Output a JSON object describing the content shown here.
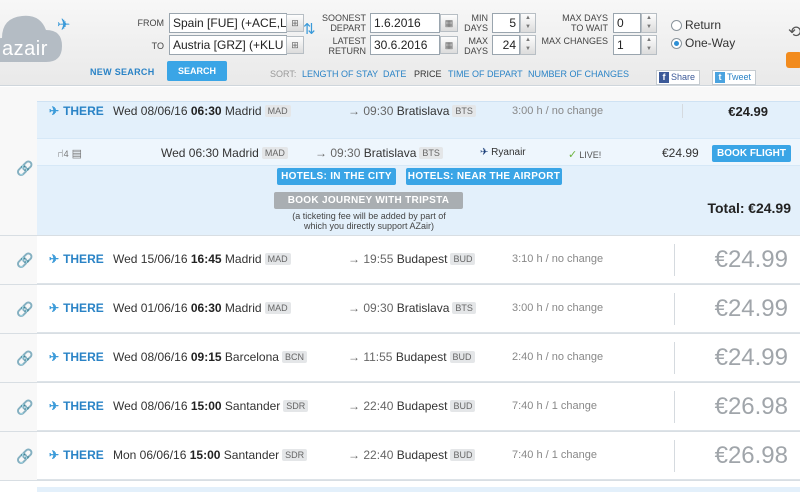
{
  "brand": {
    "logo_text": "azair"
  },
  "search": {
    "from_label": "FROM",
    "from_value": "Spain [FUE] (+ACE,L",
    "to_label": "TO",
    "to_value": "Austria [GRZ] (+KLU",
    "soonest_depart_label_1": "SOONEST",
    "soonest_depart_label_2": "DEPART",
    "soonest_depart_value": "1.6.2016",
    "latest_return_label_1": "LATEST",
    "latest_return_label_2": "RETURN",
    "latest_return_value": "30.6.2016",
    "min_days_label_1": "MIN",
    "min_days_label_2": "DAYS",
    "min_days_value": "5",
    "max_days_label_1": "MAX",
    "max_days_label_2": "DAYS",
    "max_days_value": "24",
    "max_wait_label_1": "MAX DAYS",
    "max_wait_label_2": "TO WAIT",
    "max_wait_value": "0",
    "max_changes_label": "MAX CHANGES",
    "max_changes_value": "1",
    "trip_type_options": [
      "Return",
      "One-Way"
    ],
    "trip_type_selected": "One-Way",
    "new_search_label": "NEW SEARCH",
    "search_button_label": "SEARCH"
  },
  "sort": {
    "label": "SORT:",
    "options": [
      "LENGTH OF STAY",
      "DATE",
      "PRICE",
      "TIME OF DEPART",
      "NUMBER OF CHANGES"
    ],
    "active": "PRICE"
  },
  "social": {
    "share_label": "Share",
    "tweet_label": "Tweet"
  },
  "expanded": {
    "direction": "THERE",
    "date": "Wed 08/06/16",
    "dep_time": "06:30",
    "origin": "Madrid",
    "origin_code": "MAD",
    "arr_time": "09:30",
    "destination": "Bratislava",
    "destination_code": "BTS",
    "duration": "3:00 h / no change",
    "price": "€24.99",
    "segment": {
      "seats": "4",
      "date": "Wed 06:30",
      "origin": "Madrid",
      "origin_code": "MAD",
      "arr_time": "09:30",
      "destination": "Bratislava",
      "destination_code": "BTS",
      "airline": "Ryanair",
      "live": "LIVE!",
      "price": "€24.99",
      "book_label": "BOOK FLIGHT"
    },
    "hotels_city_label": "HOTELS: IN THE CITY",
    "hotels_airport_label": "HOTELS: NEAR THE AIRPORT",
    "tripsta_label": "BOOK JOURNEY WITH TRIPSTA",
    "fee_note": "(a ticketing fee will be added by part of which you directly support AZair)",
    "total_label": "Total:",
    "total_value": "€24.99"
  },
  "results": [
    {
      "direction": "THERE",
      "date": "Wed 15/06/16",
      "dep_time": "16:45",
      "origin": "Madrid",
      "origin_code": "MAD",
      "arr_time": "19:55",
      "destination": "Budapest",
      "destination_code": "BUD",
      "duration": "3:10 h / no change",
      "price": "€24.99"
    },
    {
      "direction": "THERE",
      "date": "Wed 01/06/16",
      "dep_time": "06:30",
      "origin": "Madrid",
      "origin_code": "MAD",
      "arr_time": "09:30",
      "destination": "Bratislava",
      "destination_code": "BTS",
      "duration": "3:00 h / no change",
      "price": "€24.99"
    },
    {
      "direction": "THERE",
      "date": "Wed 08/06/16",
      "dep_time": "09:15",
      "origin": "Barcelona",
      "origin_code": "BCN",
      "arr_time": "11:55",
      "destination": "Budapest",
      "destination_code": "BUD",
      "duration": "2:40 h / no change",
      "price": "€24.99"
    },
    {
      "direction": "THERE",
      "date": "Wed 08/06/16",
      "dep_time": "15:00",
      "origin": "Santander",
      "origin_code": "SDR",
      "arr_time": "22:40",
      "destination": "Budapest",
      "destination_code": "BUD",
      "duration": "7:40 h / 1 change",
      "price": "€26.98"
    },
    {
      "direction": "THERE",
      "date": "Mon 06/06/16",
      "dep_time": "15:00",
      "origin": "Santander",
      "origin_code": "SDR",
      "arr_time": "22:40",
      "destination": "Budapest",
      "destination_code": "BUD",
      "duration": "7:40 h / 1 change",
      "price": "€26.98"
    }
  ]
}
